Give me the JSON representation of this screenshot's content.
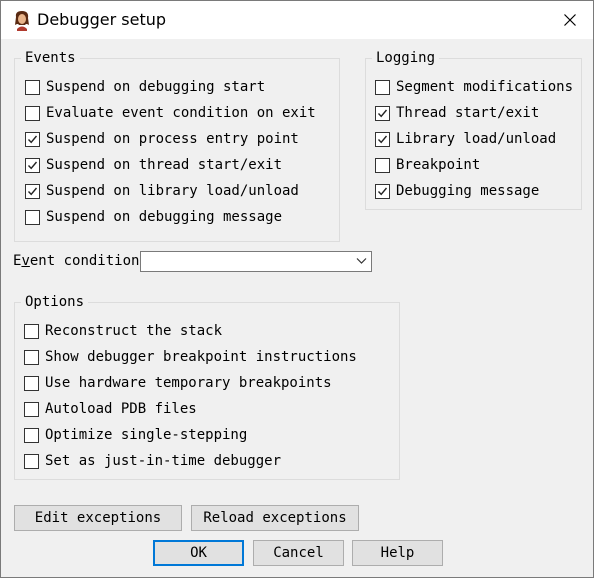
{
  "window": {
    "title": "Debugger setup"
  },
  "events": {
    "title": "Events",
    "items": [
      {
        "label": "Suspend on debugging start",
        "checked": false
      },
      {
        "label": "Evaluate event condition on exit",
        "checked": false
      },
      {
        "label": "Suspend on process entry point",
        "checked": true
      },
      {
        "label": "Suspend on thread start/exit",
        "checked": true
      },
      {
        "label": "Suspend on library load/unload",
        "checked": true
      },
      {
        "label": "Suspend on debugging message",
        "checked": false
      }
    ]
  },
  "logging": {
    "title": "Logging",
    "items": [
      {
        "label": "Segment modifications",
        "checked": false
      },
      {
        "label": "Thread start/exit",
        "checked": true
      },
      {
        "label": "Library load/unload",
        "checked": true
      },
      {
        "label": "Breakpoint",
        "checked": false
      },
      {
        "label": "Debugging message",
        "checked": true
      }
    ]
  },
  "event_condition": {
    "label_prefix": "E",
    "label_underlined": "v",
    "label_rest": "ent condition",
    "value": ""
  },
  "options": {
    "title": "Options",
    "items": [
      {
        "label": "Reconstruct the stack",
        "checked": false
      },
      {
        "label": "Show debugger breakpoint instructions",
        "checked": false
      },
      {
        "label": "Use hardware temporary breakpoints",
        "checked": false
      },
      {
        "label": "Autoload PDB files",
        "checked": false
      },
      {
        "label": "Optimize single-stepping",
        "checked": false
      },
      {
        "label": "Set as just-in-time debugger",
        "checked": false
      }
    ]
  },
  "buttons": {
    "edit_exceptions": "Edit exceptions",
    "reload_exceptions": "Reload exceptions",
    "ok": "OK",
    "cancel": "Cancel",
    "help": "Help"
  },
  "colors": {
    "dialog_bg": "#f0f0f0",
    "titlebar_bg": "#ffffff",
    "default_button_border": "#0078d7"
  }
}
